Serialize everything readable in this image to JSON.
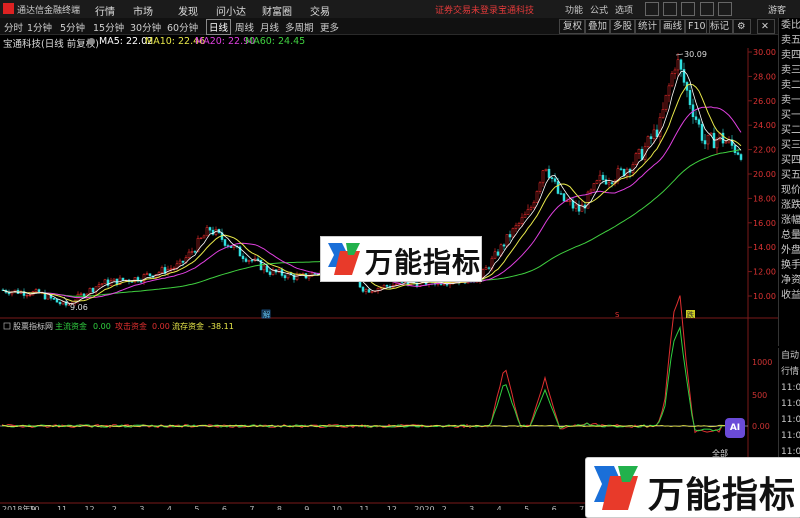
{
  "app": {
    "title": "通达信金融终端"
  },
  "menu": [
    "行情",
    "市场",
    "发现",
    "问小达",
    "财富圈",
    "交易"
  ],
  "notice": "证券交易未登录",
  "stock_tag": "宝通科技",
  "right_menu": [
    "功能",
    "公式",
    "选项"
  ],
  "guest": "游客",
  "toolbar": {
    "periods": [
      "分时",
      "1分钟",
      "5分钟",
      "15分钟",
      "30分钟",
      "60分钟",
      "日线",
      "周线",
      "月线",
      "多周期",
      "更多"
    ],
    "active_period": "日线",
    "right_buttons": [
      "复权",
      "叠加",
      "多股",
      "统计",
      "画线",
      "F10",
      "标记"
    ]
  },
  "info": {
    "name": "宝通科技(日线 前复权)",
    "ma5": "MA5: 22.02",
    "ma10": "MA10: 22.46",
    "ma20": "MA20: 22.90",
    "ma60": "MA60: 24.45"
  },
  "colors": {
    "ma5": "#ffffff",
    "ma10": "#e8e84a",
    "ma20": "#e040e0",
    "ma60": "#40d040",
    "up": "#ff3030",
    "down": "#30e0e0"
  },
  "price_axis": [
    "30.00",
    "28.00",
    "26.00",
    "24.00",
    "22.00",
    "20.00",
    "18.00",
    "16.00",
    "14.00",
    "12.00",
    "10.00"
  ],
  "price_markers": {
    "high": "30.09",
    "low": "9.06"
  },
  "event_markers": [
    "解",
    "S",
    "跌"
  ],
  "side_panel": [
    "委比",
    "卖五",
    "卖四",
    "卖三",
    "卖二",
    "卖一",
    "买一",
    "买二",
    "买三",
    "买四",
    "买五",
    "现价",
    "涨跌",
    "涨幅",
    "总量",
    "外盘",
    "换手",
    "净资",
    "收益"
  ],
  "indicator": {
    "name": "股票指标网",
    "main_label": "主流资金",
    "main_val": "0.00",
    "attack_label": "攻击资金",
    "attack_val": "0.00",
    "float_label": "流存资金",
    "float_val": "-38.11",
    "axis": [
      "1000",
      "500",
      "0.00"
    ],
    "side": [
      "自动",
      "行情",
      "11:0",
      "11:0",
      "11:0",
      "11:0",
      "11:0",
      "11:0",
      "11:0"
    ]
  },
  "date_axis": [
    "2018年9",
    "10",
    "11",
    "12",
    "2",
    "3",
    "4",
    "5",
    "6",
    "7",
    "8",
    "9",
    "10",
    "11",
    "12",
    "2020",
    "2",
    "3",
    "4",
    "5",
    "6",
    "7",
    "8",
    "9",
    "10",
    "11",
    "12"
  ],
  "watermark": {
    "text": "万能指标"
  },
  "ai_badge": "AI",
  "ai_tip": "全部"
}
